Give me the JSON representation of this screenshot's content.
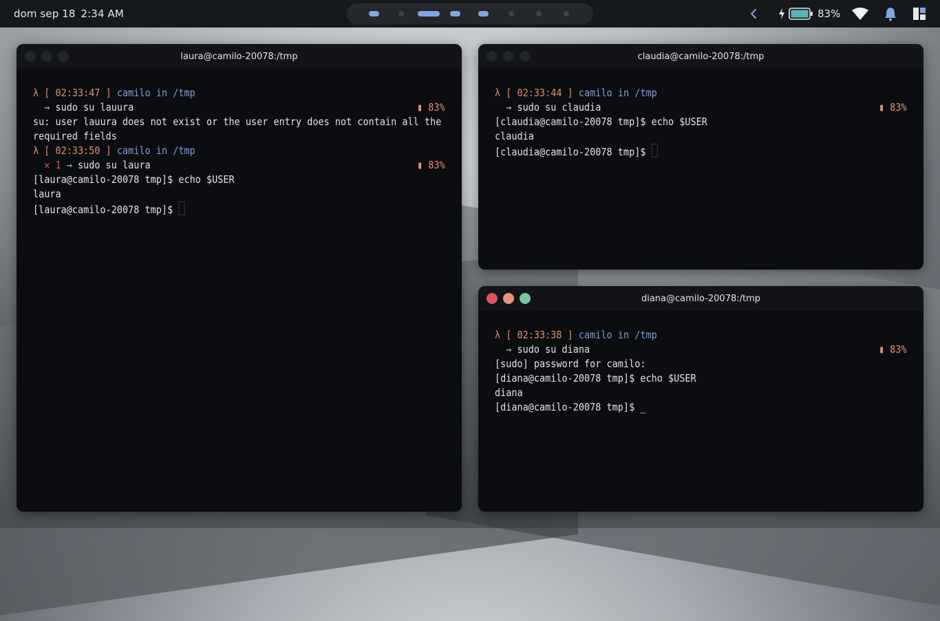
{
  "topbar": {
    "day_date": "dom sep 18",
    "time": "2:34 AM",
    "battery_percent": "83%",
    "workspaces": [
      {
        "active": true,
        "wide": false
      },
      {
        "active": false,
        "wide": false
      },
      {
        "active": true,
        "wide": true
      },
      {
        "active": true,
        "wide": false
      },
      {
        "active": true,
        "wide": false
      },
      {
        "active": false,
        "wide": false
      },
      {
        "active": false,
        "wide": false
      },
      {
        "active": false,
        "wide": false
      }
    ]
  },
  "windows": {
    "laura": {
      "title": "laura@camilo-20078:/tmp",
      "lines": [
        {
          "type": "prompt",
          "time": "02:33:47",
          "user": "camilo in /tmp"
        },
        {
          "type": "cmd",
          "text": "sudo su lauura",
          "batt": "83%"
        },
        {
          "type": "out",
          "text": "su: user lauura does not exist or the user entry does not contain all the"
        },
        {
          "type": "out",
          "text": "required fields"
        },
        {
          "type": "prompt",
          "time": "02:33:50",
          "user": "camilo in /tmp"
        },
        {
          "type": "errcmd",
          "code": "1",
          "text": "sudo su laura",
          "batt": "83%"
        },
        {
          "type": "out",
          "text": "[laura@camilo-20078 tmp]$ echo $USER"
        },
        {
          "type": "out",
          "text": "laura"
        },
        {
          "type": "shell",
          "text": "[laura@camilo-20078 tmp]$ ",
          "cursor": "box"
        }
      ]
    },
    "claudia": {
      "title": "claudia@camilo-20078:/tmp",
      "lines": [
        {
          "type": "prompt",
          "time": "02:33:44",
          "user": "camilo in /tmp"
        },
        {
          "type": "cmd",
          "text": "sudo su claudia",
          "batt": "83%"
        },
        {
          "type": "out",
          "text": "[claudia@camilo-20078 tmp]$ echo $USER"
        },
        {
          "type": "out",
          "text": "claudia"
        },
        {
          "type": "shell",
          "text": "[claudia@camilo-20078 tmp]$ ",
          "cursor": "box"
        }
      ]
    },
    "diana": {
      "title": "diana@camilo-20078:/tmp",
      "lines": [
        {
          "type": "prompt",
          "time": "02:33:38",
          "user": "camilo in /tmp"
        },
        {
          "type": "cmd",
          "text": "sudo su diana",
          "batt": "83%"
        },
        {
          "type": "out",
          "text": "[sudo] password for camilo:"
        },
        {
          "type": "out",
          "text": "[diana@camilo-20078 tmp]$ echo $USER"
        },
        {
          "type": "out",
          "text": "diana"
        },
        {
          "type": "shell",
          "text": "[diana@camilo-20078 tmp]$ ",
          "cursor": "_"
        }
      ]
    }
  },
  "colors": {
    "accent_blue": "#7f9ed8",
    "prompt_orange": "#e38f6f",
    "error_red": "#e0545f",
    "arrow_green": "#a7c9a8",
    "terminal_bg": "#0b0d10"
  }
}
